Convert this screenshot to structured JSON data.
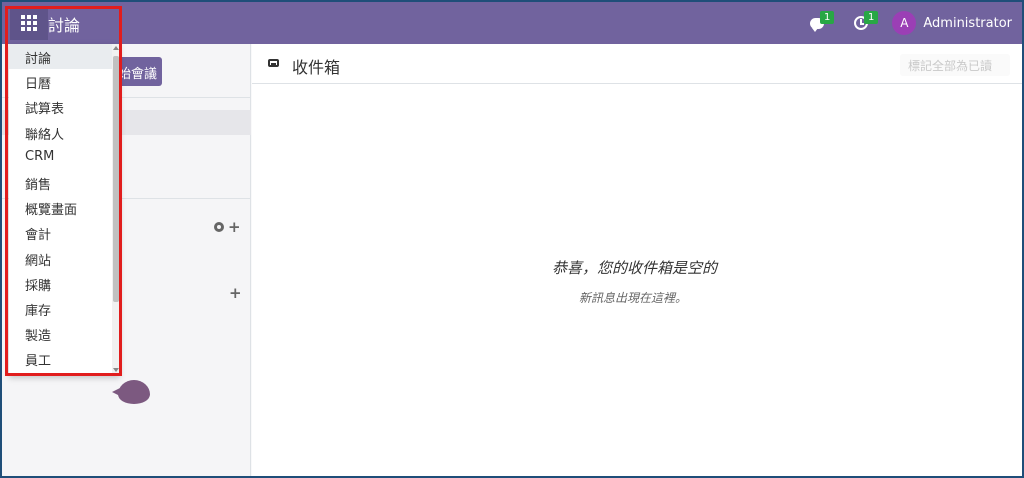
{
  "navbar": {
    "brand": "討論",
    "messages_count": "1",
    "activities_count": "1",
    "user_initial": "A",
    "user_name": "Administrator"
  },
  "sidebar": {
    "start_meeting_label": "始會議"
  },
  "main": {
    "title": "收件箱",
    "mark_all_read": "標記全部為已讀",
    "empty_title": "恭喜，您的收件箱是空的",
    "empty_subtitle": "新訊息出現在這裡。"
  },
  "app_menu": {
    "items": [
      "討論",
      "日曆",
      "試算表",
      "聯絡人",
      "CRM",
      "銷售",
      "概覽畫面",
      "會計",
      "網站",
      "採購",
      "庫存",
      "製造",
      "員工"
    ],
    "selected": "討論"
  },
  "colors": {
    "navbar": "#71639e",
    "highlight": "#e11d1d",
    "badge": "#28a745",
    "avatar": "#9b3fb5"
  }
}
